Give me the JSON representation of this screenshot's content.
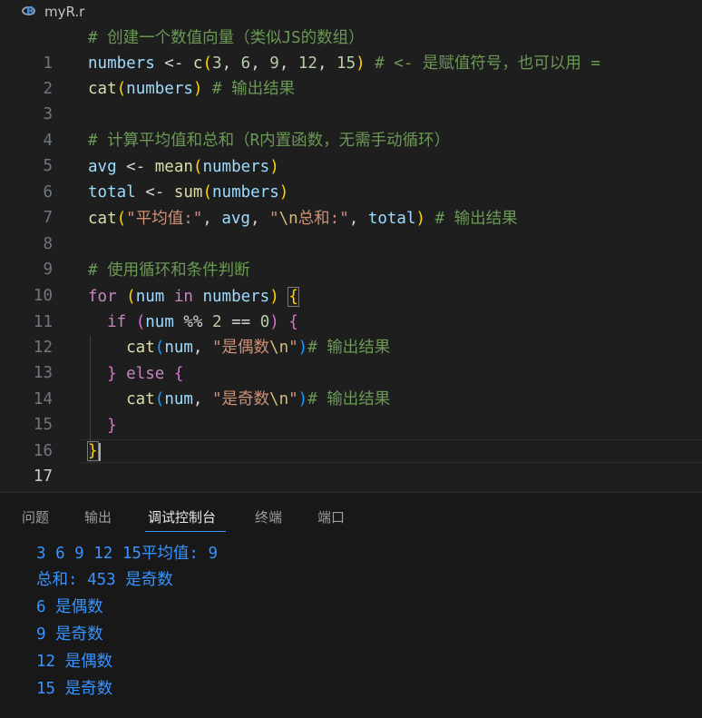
{
  "tab": {
    "filename": "myR.r",
    "icon": "r-language-icon"
  },
  "editor": {
    "line_numbers": [
      "1",
      "2",
      "3",
      "4",
      "5",
      "6",
      "7",
      "8",
      "9",
      "10",
      "11",
      "12",
      "13",
      "14",
      "15",
      "16",
      "17"
    ],
    "active_line": "17",
    "code": {
      "l1_comment": "# 创建一个数值向量（类似JS的数组）",
      "l2_a": "numbers",
      "l2_b": " <- ",
      "l2_c": "c",
      "l2_d": "(",
      "l2_e": "3",
      "l2_f": ", ",
      "l2_g": "6",
      "l2_h": ", ",
      "l2_i": "9",
      "l2_j": ", ",
      "l2_k": "12",
      "l2_l": ", ",
      "l2_m": "15",
      "l2_n": ")",
      "l2_comment": " # <- 是赋值符号，也可以用 =",
      "l3_a": "cat",
      "l3_b": "(",
      "l3_c": "numbers",
      "l3_d": ")",
      "l3_comment": " # 输出结果",
      "l5_comment": "# 计算平均值和总和（R内置函数，无需手动循环）",
      "l6_a": "avg",
      "l6_b": " <- ",
      "l6_c": "mean",
      "l6_d": "(",
      "l6_e": "numbers",
      "l6_f": ")",
      "l7_a": "total",
      "l7_b": " <- ",
      "l7_c": "sum",
      "l7_d": "(",
      "l7_e": "numbers",
      "l7_f": ")",
      "l8_a": "cat",
      "l8_b": "(",
      "l8_c": "\"平均值:\"",
      "l8_d": ", ",
      "l8_e": "avg",
      "l8_f": ", ",
      "l8_g": "\"",
      "l8_h": "\\n",
      "l8_i": "总和:\"",
      "l8_j": ", ",
      "l8_k": "total",
      "l8_l": ")",
      "l8_comment": " # 输出结果",
      "l10_comment": "# 使用循环和条件判断",
      "l11_a": "for",
      "l11_b": " ",
      "l11_c": "(",
      "l11_d": "num",
      "l11_e": " in ",
      "l11_f": "numbers",
      "l11_g": ")",
      "l11_h": " ",
      "l11_i": "{",
      "l12_a": "  if",
      "l12_b": " ",
      "l12_c": "(",
      "l12_d": "num",
      "l12_e": " %% ",
      "l12_f": "2",
      "l12_g": " == ",
      "l12_h": "0",
      "l12_i": ")",
      "l12_j": " ",
      "l12_k": "{",
      "l13_a": "    cat",
      "l13_b": "(",
      "l13_c": "num",
      "l13_d": ", ",
      "l13_e": "\"是偶数",
      "l13_f": "\\n",
      "l13_g": "\"",
      "l13_h": ")",
      "l13_comment": "# 输出结果",
      "l14_a": "  }",
      "l14_b": " else ",
      "l14_c": "{",
      "l15_a": "    cat",
      "l15_b": "(",
      "l15_c": "num",
      "l15_d": ", ",
      "l15_e": "\"是奇数",
      "l15_f": "\\n",
      "l15_g": "\"",
      "l15_h": ")",
      "l15_comment": "# 输出结果",
      "l16_a": "  }",
      "l17_a": "}"
    }
  },
  "panel": {
    "tabs": [
      "问题",
      "输出",
      "调试控制台",
      "终端",
      "端口"
    ],
    "active_tab": "调试控制台",
    "output_lines": [
      "3 6 9 12 15平均值: 9",
      "总和: 453 是奇数",
      "6 是偶数",
      "9 是奇数",
      "12 是偶数",
      "15 是奇数"
    ]
  },
  "colors": {
    "background": "#1e1e1e",
    "comment": "#6a9955",
    "variable": "#9cdcfe",
    "function": "#dcdcaa",
    "number": "#b5cea8",
    "string": "#ce9178",
    "keyword": "#c586c0",
    "output_text": "#3794ff"
  }
}
